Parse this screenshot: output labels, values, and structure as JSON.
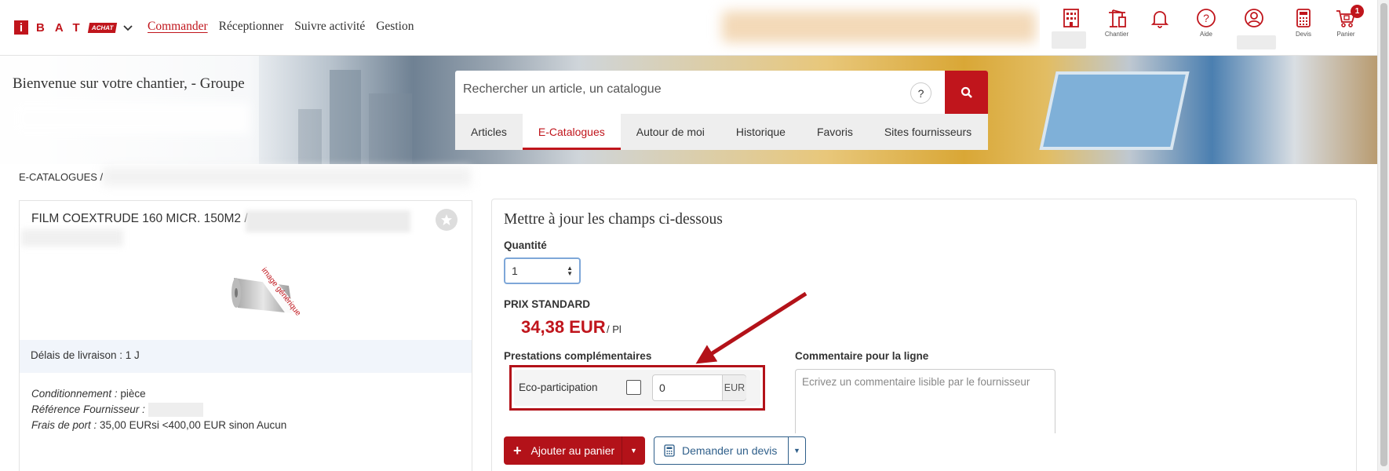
{
  "logo": {
    "letter": "i",
    "letters": "BAT",
    "badge": "ACHAT"
  },
  "nav": {
    "items": [
      "Commander",
      "Réceptionner",
      "Suivre activité",
      "Gestion"
    ],
    "active": 0
  },
  "header_icons": {
    "chantier": "Chantier",
    "aide": "Aide",
    "devis": "Devis",
    "panier": "Panier",
    "cart_count": "1"
  },
  "banner": {
    "welcome": "Bienvenue sur votre chantier, - Groupe"
  },
  "search": {
    "placeholder": "Rechercher un article, un catalogue",
    "help": "?",
    "tabs": [
      "Articles",
      "E-Catalogues",
      "Autour de moi",
      "Historique",
      "Favoris",
      "Sites fournisseurs"
    ],
    "active_tab": 1
  },
  "breadcrumb": "E-CATALOGUES /",
  "product": {
    "title": "FILM COEXTRUDE 160 MICR. 150M2 /",
    "image_ribbon": "image générique",
    "delivery": "Délais de livraison : 1 J",
    "conditionnement_label": "Conditionnement :",
    "conditionnement_value": " pièce",
    "reference_label": "Référence Fournisseur :",
    "frais_label": "Frais de port :",
    "frais_value": " 35,00 EURsi <400,00 EUR sinon Aucun"
  },
  "form": {
    "title": "Mettre à jour les champs ci-dessous",
    "quantity_label": "Quantité",
    "quantity_value": "1",
    "price_label": "PRIX STANDARD",
    "price": "34,38 EUR",
    "price_unit": "/ Pl",
    "prestations_label": "Prestations complémentaires",
    "eco_label": "Eco-participation",
    "eco_value": "0",
    "eco_unit": "EUR",
    "comment_label": "Commentaire pour la ligne",
    "comment_placeholder": "Ecrivez un commentaire lisible par le fournisseur",
    "add_button": "Ajouter au panier",
    "devis_button": "Demander un devis"
  },
  "colors": {
    "brand_red": "#c0151c",
    "annotation_red": "#b31219",
    "link_blue": "#2f5f8a"
  }
}
